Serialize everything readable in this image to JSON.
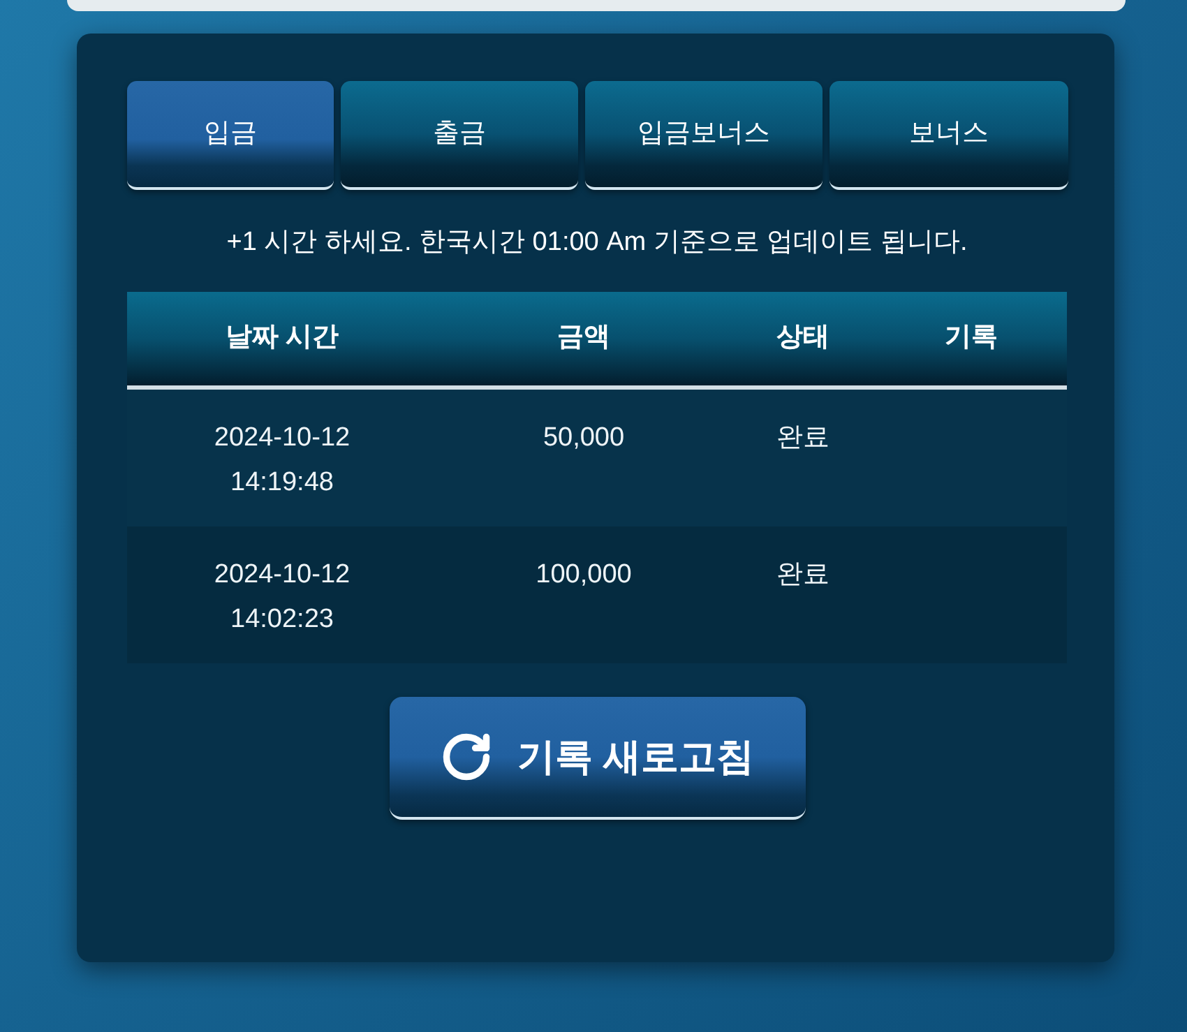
{
  "tabs": [
    {
      "label": "입금",
      "selected": true
    },
    {
      "label": "출금",
      "selected": false
    },
    {
      "label": "입금보너스",
      "selected": false
    },
    {
      "label": "보너스",
      "selected": false
    }
  ],
  "notice": "+1 시간 하세요. 한국시간 01:00 Am 기준으로 업데이트 됩니다.",
  "table": {
    "columns": [
      "날짜 시간",
      "금액",
      "상태",
      "기록"
    ],
    "rows": [
      {
        "date": "2024-10-12",
        "time": "14:19:48",
        "amount": "50,000",
        "status": "완료"
      },
      {
        "date": "2024-10-12",
        "time": "14:02:23",
        "amount": "100,000",
        "status": "완료"
      }
    ]
  },
  "refresh_button": {
    "label": "기록 새로고침"
  }
}
